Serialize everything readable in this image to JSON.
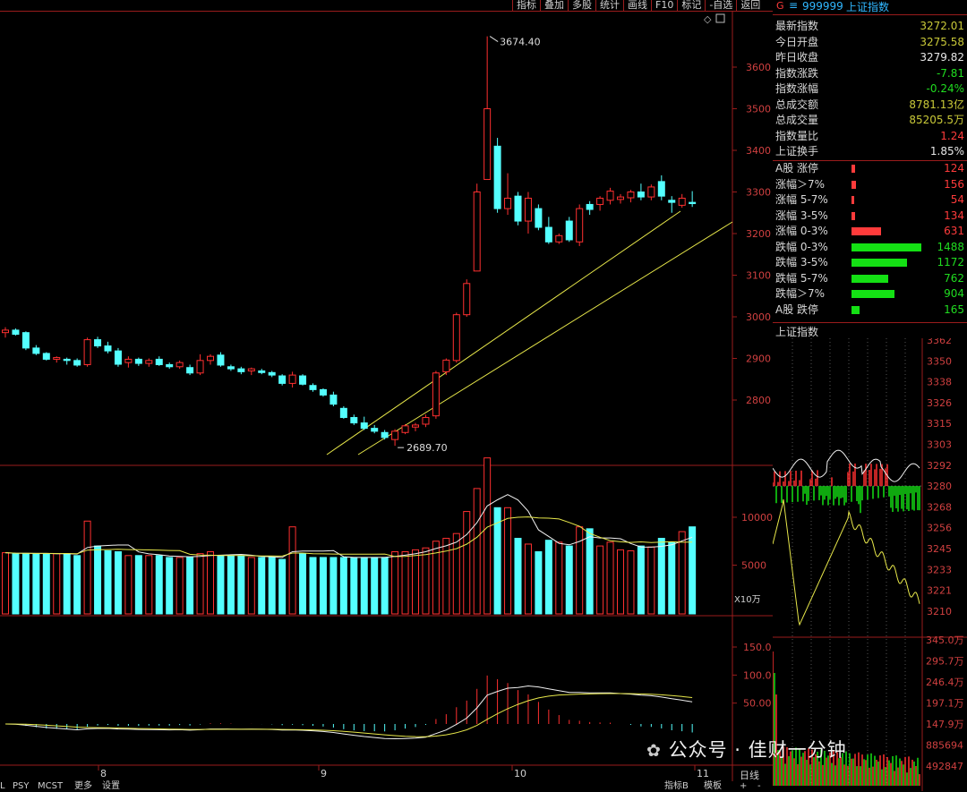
{
  "toolbar": {
    "items": [
      "指标",
      "叠加",
      "多股",
      "统计",
      "画线",
      "F10",
      "标记",
      "-自选",
      "返回"
    ]
  },
  "main_chart": {
    "price_axis": [
      "3600",
      "3500",
      "3400",
      "3300",
      "3200",
      "3100",
      "3000",
      "2900",
      "2800"
    ],
    "high_label": "3674.40",
    "low_label": "2689.70",
    "volume_axis": [
      "10000",
      "5000"
    ],
    "volume_unit": "X10万",
    "macd_axis": [
      "150.0",
      "100.0",
      "50.00"
    ],
    "date_labels": [
      "8",
      "9",
      "10",
      "11"
    ]
  },
  "chart_data": {
    "type": "candlestick",
    "series_name": "上证指数",
    "candles": [
      [
        2962,
        2975,
        2950,
        2968
      ],
      [
        2968,
        2972,
        2955,
        2958
      ],
      [
        2962,
        2965,
        2920,
        2925
      ],
      [
        2925,
        2932,
        2908,
        2912
      ],
      [
        2912,
        2915,
        2895,
        2898
      ],
      [
        2898,
        2905,
        2890,
        2902
      ],
      [
        2898,
        2902,
        2885,
        2895
      ],
      [
        2895,
        2900,
        2880,
        2884
      ],
      [
        2885,
        2950,
        2880,
        2945
      ],
      [
        2945,
        2952,
        2925,
        2930
      ],
      [
        2930,
        2940,
        2912,
        2918
      ],
      [
        2918,
        2925,
        2880,
        2886
      ],
      [
        2890,
        2905,
        2878,
        2898
      ],
      [
        2898,
        2902,
        2882,
        2888
      ],
      [
        2888,
        2900,
        2880,
        2895
      ],
      [
        2898,
        2905,
        2882,
        2885
      ],
      [
        2885,
        2890,
        2875,
        2880
      ],
      [
        2880,
        2895,
        2875,
        2890
      ],
      [
        2878,
        2885,
        2860,
        2865
      ],
      [
        2865,
        2910,
        2860,
        2895
      ],
      [
        2895,
        2910,
        2885,
        2905
      ],
      [
        2908,
        2915,
        2880,
        2884
      ],
      [
        2880,
        2885,
        2870,
        2875
      ],
      [
        2875,
        2880,
        2862,
        2868
      ],
      [
        2870,
        2878,
        2860,
        2875
      ],
      [
        2870,
        2875,
        2862,
        2866
      ],
      [
        2866,
        2870,
        2855,
        2860
      ],
      [
        2858,
        2862,
        2835,
        2840
      ],
      [
        2840,
        2868,
        2830,
        2860
      ],
      [
        2858,
        2862,
        2835,
        2838
      ],
      [
        2835,
        2840,
        2820,
        2825
      ],
      [
        2825,
        2828,
        2808,
        2812
      ],
      [
        2812,
        2820,
        2785,
        2790
      ],
      [
        2780,
        2785,
        2755,
        2758
      ],
      [
        2758,
        2765,
        2740,
        2745
      ],
      [
        2745,
        2760,
        2728,
        2732
      ],
      [
        2732,
        2740,
        2720,
        2725
      ],
      [
        2722,
        2728,
        2705,
        2710
      ],
      [
        2705,
        2730,
        2690,
        2725
      ],
      [
        2722,
        2742,
        2718,
        2738
      ],
      [
        2735,
        2745,
        2725,
        2740
      ],
      [
        2742,
        2765,
        2735,
        2758
      ],
      [
        2762,
        2870,
        2755,
        2865
      ],
      [
        2868,
        2900,
        2860,
        2896
      ],
      [
        2895,
        3010,
        2890,
        3005
      ],
      [
        3005,
        3090,
        3000,
        3080
      ],
      [
        3110,
        3320,
        3150,
        3300
      ],
      [
        3330,
        3674,
        3380,
        3500
      ],
      [
        3410,
        3430,
        3250,
        3260
      ],
      [
        3260,
        3345,
        3245,
        3285
      ],
      [
        3290,
        3300,
        3220,
        3230
      ],
      [
        3230,
        3300,
        3200,
        3285
      ],
      [
        3260,
        3270,
        3208,
        3215
      ],
      [
        3215,
        3240,
        3175,
        3180
      ],
      [
        3180,
        3200,
        3175,
        3195
      ],
      [
        3230,
        3240,
        3180,
        3185
      ],
      [
        3180,
        3270,
        3170,
        3260
      ],
      [
        3270,
        3278,
        3245,
        3258
      ],
      [
        3270,
        3290,
        3255,
        3285
      ],
      [
        3280,
        3310,
        3270,
        3302
      ],
      [
        3282,
        3295,
        3272,
        3288
      ],
      [
        3286,
        3305,
        3275,
        3300
      ],
      [
        3300,
        3320,
        3280,
        3288
      ],
      [
        3288,
        3318,
        3280,
        3312
      ],
      [
        3325,
        3340,
        3280,
        3290
      ],
      [
        3280,
        3290,
        3250,
        3275
      ],
      [
        3268,
        3295,
        3262,
        3285
      ],
      [
        3275,
        3302,
        3264,
        3272
      ]
    ],
    "volume": [
      6300,
      6200,
      6200,
      6200,
      6200,
      6200,
      6200,
      6000,
      9600,
      7000,
      6500,
      6400,
      6000,
      6000,
      6000,
      6000,
      5800,
      5800,
      5800,
      6200,
      6400,
      6000,
      6000,
      6000,
      5800,
      5800,
      5800,
      5600,
      9000,
      6200,
      5800,
      5800,
      5800,
      5800,
      5800,
      5800,
      5800,
      5800,
      6400,
      6400,
      6600,
      6800,
      7500,
      7800,
      8300,
      10600,
      13000,
      16200,
      11000,
      11000,
      7800,
      7200,
      6400,
      7600,
      7400,
      7000,
      9000,
      8800,
      7000,
      7400,
      6600,
      6500,
      7000,
      6900,
      7800,
      7400,
      8500,
      9000
    ],
    "macd_axis_max": 150
  },
  "panel": {
    "code": "999999",
    "name": "上证指数",
    "g_label": "G",
    "menu_icon": "≡",
    "rows": [
      {
        "label": "最新指数",
        "value": "3272.01",
        "cls": "yel"
      },
      {
        "label": "今日开盘",
        "value": "3275.58",
        "cls": "yel"
      },
      {
        "label": "昨日收盘",
        "value": "3279.82",
        "cls": "wht"
      },
      {
        "label": "指数涨跌",
        "value": "-7.81",
        "cls": "grn"
      },
      {
        "label": "指数涨幅",
        "value": "-0.24%",
        "cls": "grn"
      },
      {
        "label": "总成交额",
        "value": "8781.13亿",
        "cls": "yel"
      },
      {
        "label": "总成交量",
        "value": "85205.5万",
        "cls": "yel"
      },
      {
        "label": "指数量比",
        "value": "1.24",
        "cls": "red"
      },
      {
        "label": "上证换手",
        "value": "1.85%",
        "cls": "wht"
      }
    ],
    "breadth": [
      {
        "label": "A股 涨停",
        "value": "124",
        "color": "red",
        "frac": 0.05
      },
      {
        "label": "涨幅＞7%",
        "value": "156",
        "color": "red",
        "frac": 0.06
      },
      {
        "label": "涨幅 5-7%",
        "value": "54",
        "color": "red",
        "frac": 0.02
      },
      {
        "label": "涨幅 3-5%",
        "value": "134",
        "color": "red",
        "frac": 0.05
      },
      {
        "label": "涨幅 0-3%",
        "value": "631",
        "color": "red",
        "frac": 0.42
      },
      {
        "label": "跌幅 0-3%",
        "value": "1488",
        "color": "green",
        "frac": 1.0
      },
      {
        "label": "跌幅 3-5%",
        "value": "1172",
        "color": "green",
        "frac": 0.79
      },
      {
        "label": "跌幅 5-7%",
        "value": "762",
        "color": "green",
        "frac": 0.52
      },
      {
        "label": "跌幅＞7%",
        "value": "904",
        "color": "green",
        "frac": 0.61
      },
      {
        "label": "A股 跌停",
        "value": "165",
        "color": "green",
        "frac": 0.11
      }
    ],
    "mini_title": "上证指数",
    "mini_axis": [
      "3362",
      "3350",
      "3338",
      "3326",
      "3315",
      "3303",
      "3292",
      "3280",
      "3268",
      "3256",
      "3245",
      "3233",
      "3221",
      "3210"
    ],
    "mini_vol_axis": [
      "345.0万",
      "295.7万",
      "246.4万",
      "197.1万",
      "147.9万",
      "885694",
      "492847"
    ]
  },
  "bottom": {
    "left_items": [
      "L",
      "PSY",
      "MCST",
      "更多",
      "设置"
    ],
    "right_items": [
      "指标B",
      "模板"
    ],
    "day_line": "日线",
    "watermark": "公众号 · 佳财一分钟"
  }
}
